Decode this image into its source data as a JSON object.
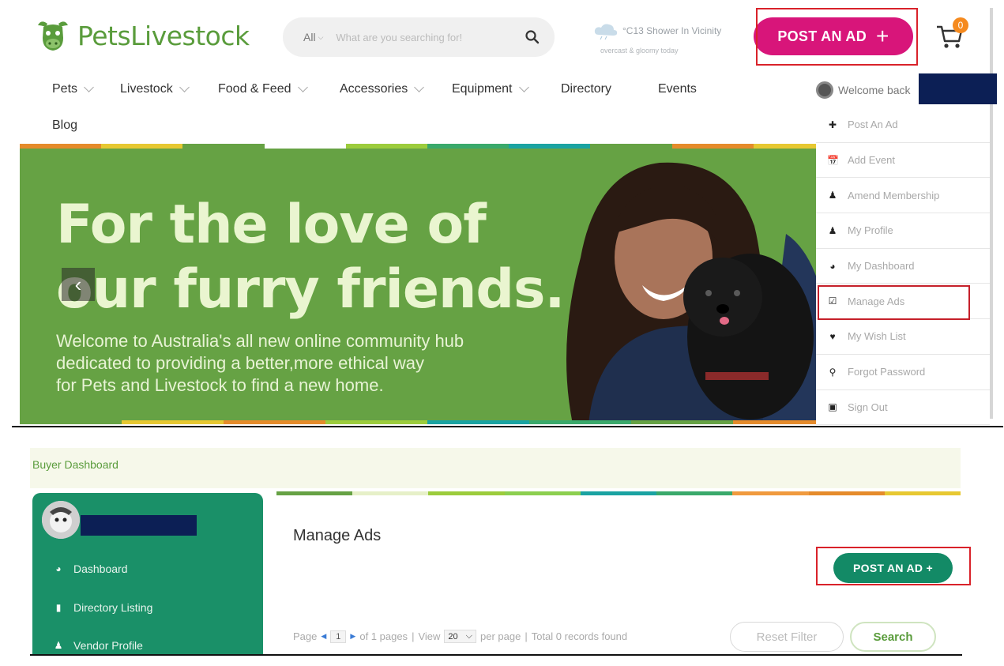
{
  "header": {
    "logo_text": "PetsLivestock",
    "search": {
      "category": "All",
      "placeholder": "What are you searching for!"
    },
    "weather": {
      "line1": "°C13 Shower In Vicinity",
      "line2": "overcast & gloomy today"
    },
    "post_ad_label": "POST AN AD",
    "cart_count": "0"
  },
  "nav": {
    "items": [
      "Pets",
      "Livestock",
      "Food & Feed",
      "Accessories",
      "Equipment",
      "Directory",
      "Events"
    ],
    "blog": "Blog",
    "welcome": "Welcome back"
  },
  "hero": {
    "title_line1": "For the love of",
    "title_line2": "our furry friends.",
    "subtitle_line1": "Welcome to Australia's all new online community hub",
    "subtitle_line2": "dedicated to providing a better,more ethical way",
    "subtitle_line3": "for Pets and Livestock to find a new home."
  },
  "user_menu": {
    "items": [
      "Post An Ad",
      "Add Event",
      "Amend Membership",
      "My Profile",
      "My Dashboard",
      "Manage Ads",
      "My Wish List",
      "Forgot Password",
      "Sign Out"
    ]
  },
  "dashboard": {
    "title": "Buyer Dashboard",
    "sidebar": [
      "Dashboard",
      "Directory Listing",
      "Vendor Profile"
    ],
    "page_title": "Manage Ads",
    "post_ad_label": "POST AN AD +",
    "pager": {
      "page_label": "Page",
      "page_value": "1",
      "of_pages": "of 1 pages",
      "view_label": "View",
      "view_value": "20",
      "per_page": "per page",
      "total": "Total 0 records found"
    },
    "reset_label": "Reset Filter",
    "search_label": "Search"
  },
  "colors": {
    "brand_green": "#5a9c3c",
    "hero_green": "#66a244",
    "post_pink": "#d8157a",
    "dash_green": "#1a9068",
    "highlight_red": "#d9222a"
  }
}
